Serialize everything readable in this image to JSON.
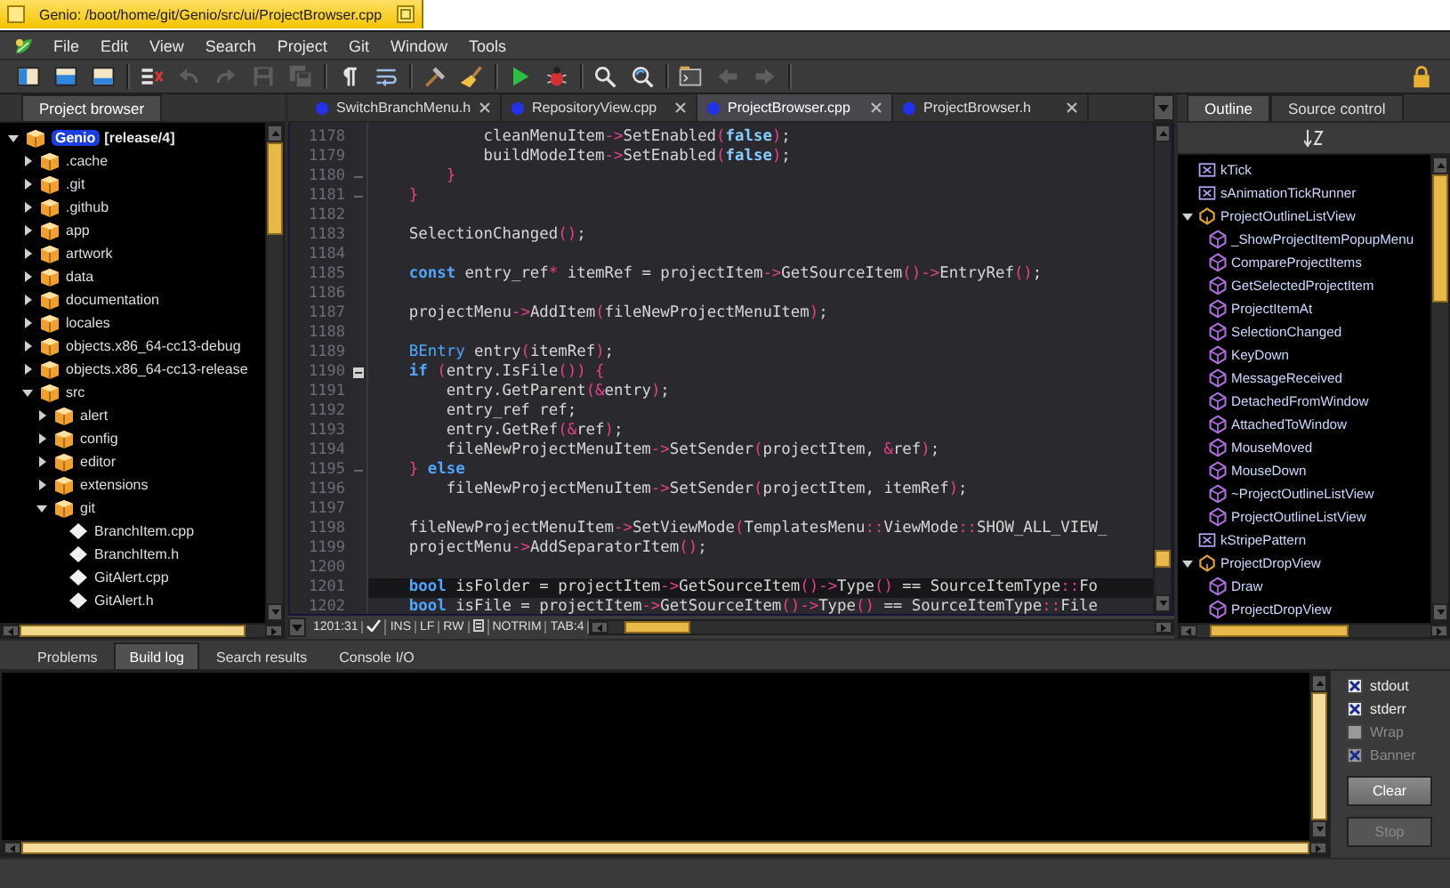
{
  "window": {
    "title": "Genio: /boot/home/git/Genio/src/ui/ProjectBrowser.cpp"
  },
  "menu": [
    "File",
    "Edit",
    "View",
    "Search",
    "Project",
    "Git",
    "Window",
    "Tools"
  ],
  "toolbar_groups": [
    [
      {
        "kind": "left-pane",
        "disabled": false
      },
      {
        "kind": "top-pane",
        "disabled": false
      },
      {
        "kind": "bottom-pane",
        "disabled": false
      }
    ],
    [
      {
        "kind": "targets",
        "disabled": false
      },
      {
        "kind": "undo",
        "disabled": true
      },
      {
        "kind": "redo",
        "disabled": true
      },
      {
        "kind": "save",
        "disabled": true
      },
      {
        "kind": "save-all",
        "disabled": true
      }
    ],
    [
      {
        "kind": "pilcrow",
        "disabled": false
      },
      {
        "kind": "wrap",
        "disabled": false
      }
    ],
    [
      {
        "kind": "hammer",
        "disabled": false
      },
      {
        "kind": "broom",
        "disabled": false
      }
    ],
    [
      {
        "kind": "run",
        "disabled": false
      },
      {
        "kind": "debug",
        "disabled": false
      }
    ],
    [
      {
        "kind": "find",
        "disabled": false
      },
      {
        "kind": "replace",
        "disabled": false
      }
    ],
    [
      {
        "kind": "terminal",
        "disabled": false
      },
      {
        "kind": "back",
        "disabled": true
      },
      {
        "kind": "forward",
        "disabled": true
      }
    ]
  ],
  "toolbar_end": [
    {
      "kind": "lock",
      "disabled": false
    }
  ],
  "project_browser": {
    "tab": "Project browser",
    "project": {
      "name": "Genio",
      "branch": "[release/4]",
      "active": true,
      "expanded": true,
      "children": [
        {
          "label": ".cache",
          "kind": "folder",
          "expanded": false
        },
        {
          "label": ".git",
          "kind": "folder",
          "expanded": false
        },
        {
          "label": ".github",
          "kind": "folder",
          "expanded": false
        },
        {
          "label": "app",
          "kind": "folder",
          "expanded": false
        },
        {
          "label": "artwork",
          "kind": "folder",
          "expanded": false
        },
        {
          "label": "data",
          "kind": "folder",
          "expanded": false
        },
        {
          "label": "documentation",
          "kind": "folder",
          "expanded": false
        },
        {
          "label": "locales",
          "kind": "folder",
          "expanded": false
        },
        {
          "label": "objects.x86_64-cc13-debug",
          "kind": "folder",
          "expanded": false
        },
        {
          "label": "objects.x86_64-cc13-release",
          "kind": "folder",
          "expanded": false
        },
        {
          "label": "src",
          "kind": "folder",
          "expanded": true,
          "children": [
            {
              "label": "alert",
              "kind": "folder",
              "expanded": false
            },
            {
              "label": "config",
              "kind": "folder",
              "expanded": false
            },
            {
              "label": "editor",
              "kind": "folder",
              "expanded": false
            },
            {
              "label": "extensions",
              "kind": "folder",
              "expanded": false
            },
            {
              "label": "git",
              "kind": "folder",
              "expanded": true,
              "children": [
                {
                  "label": "BranchItem.cpp",
                  "kind": "file"
                },
                {
                  "label": "BranchItem.h",
                  "kind": "file"
                },
                {
                  "label": "GitAlert.cpp",
                  "kind": "file"
                },
                {
                  "label": "GitAlert.h",
                  "kind": "file"
                }
              ]
            }
          ]
        }
      ]
    }
  },
  "editor": {
    "tabs": [
      {
        "label": "SwitchBranchMenu.h",
        "selected": false
      },
      {
        "label": "RepositoryView.cpp",
        "selected": false
      },
      {
        "label": "ProjectBrowser.cpp",
        "selected": true
      },
      {
        "label": "ProjectBrowser.h",
        "selected": false
      }
    ],
    "lines": [
      {
        "number": "1178",
        "current": false,
        "tokens": [
          {
            "kind": "plain",
            "text": "            cleanMenuItem"
          },
          {
            "kind": "symbol",
            "text": "->"
          },
          {
            "kind": "plain",
            "text": "SetEnabled"
          },
          {
            "kind": "symbol",
            "text": "("
          },
          {
            "kind": "literal",
            "text": "false"
          },
          {
            "kind": "symbol",
            "text": ")"
          },
          {
            "kind": "plain",
            "text": ";"
          }
        ]
      },
      {
        "number": "1179",
        "current": false,
        "tokens": [
          {
            "kind": "plain",
            "text": "            buildModeItem"
          },
          {
            "kind": "symbol",
            "text": "->"
          },
          {
            "kind": "plain",
            "text": "SetEnabled"
          },
          {
            "kind": "symbol",
            "text": "("
          },
          {
            "kind": "literal",
            "text": "false"
          },
          {
            "kind": "symbol",
            "text": ")"
          },
          {
            "kind": "plain",
            "text": ";"
          }
        ]
      },
      {
        "number": "1180",
        "current": false,
        "fold_end": true,
        "tokens": [
          {
            "kind": "symbol",
            "text": "        }"
          }
        ]
      },
      {
        "number": "1181",
        "current": false,
        "fold_end": true,
        "tokens": [
          {
            "kind": "symbol",
            "text": "    }"
          }
        ]
      },
      {
        "number": "1182"
      },
      {
        "number": "1183",
        "current": false,
        "tokens": [
          {
            "kind": "plain",
            "text": "    SelectionChanged"
          },
          {
            "kind": "symbol",
            "text": "()"
          },
          {
            "kind": "plain",
            "text": ";"
          }
        ]
      },
      {
        "number": "1184"
      },
      {
        "number": "1185",
        "current": false,
        "tokens": [
          {
            "kind": "keyword",
            "text": "    const"
          },
          {
            "kind": "plain",
            "text": " entry_ref"
          },
          {
            "kind": "symbol",
            "text": "*"
          },
          {
            "kind": "plain",
            "text": " itemRef = projectItem"
          },
          {
            "kind": "symbol",
            "text": "->"
          },
          {
            "kind": "plain",
            "text": "GetSourceItem"
          },
          {
            "kind": "symbol",
            "text": "()->"
          },
          {
            "kind": "plain",
            "text": "EntryRef"
          },
          {
            "kind": "symbol",
            "text": "()"
          },
          {
            "kind": "plain",
            "text": ";"
          }
        ]
      },
      {
        "number": "1186"
      },
      {
        "number": "1187",
        "current": false,
        "tokens": [
          {
            "kind": "plain",
            "text": "    projectMenu"
          },
          {
            "kind": "symbol",
            "text": "->"
          },
          {
            "kind": "plain",
            "text": "AddItem"
          },
          {
            "kind": "symbol",
            "text": "("
          },
          {
            "kind": "plain",
            "text": "fileNewProjectMenuItem"
          },
          {
            "kind": "symbol",
            "text": ")"
          },
          {
            "kind": "plain",
            "text": ";"
          }
        ]
      },
      {
        "number": "1188"
      },
      {
        "number": "1189",
        "current": false,
        "tokens": [
          {
            "kind": "type",
            "text": "    BEntry"
          },
          {
            "kind": "plain",
            "text": " entry"
          },
          {
            "kind": "symbol",
            "text": "("
          },
          {
            "kind": "plain",
            "text": "itemRef"
          },
          {
            "kind": "symbol",
            "text": ")"
          },
          {
            "kind": "plain",
            "text": ";"
          }
        ]
      },
      {
        "number": "1190",
        "current": false,
        "fold_start": true,
        "tokens": [
          {
            "kind": "keyword",
            "text": "    if"
          },
          {
            "kind": "symbol",
            "text": " ("
          },
          {
            "kind": "plain",
            "text": "entry.IsFile"
          },
          {
            "kind": "symbol",
            "text": "()) {"
          }
        ]
      },
      {
        "number": "1191",
        "current": false,
        "tokens": [
          {
            "kind": "plain",
            "text": "        entry.GetParent"
          },
          {
            "kind": "symbol",
            "text": "(&"
          },
          {
            "kind": "plain",
            "text": "entry"
          },
          {
            "kind": "symbol",
            "text": ")"
          },
          {
            "kind": "plain",
            "text": ";"
          }
        ]
      },
      {
        "number": "1192",
        "current": false,
        "tokens": [
          {
            "kind": "plain",
            "text": "        entry_ref ref;"
          }
        ]
      },
      {
        "number": "1193",
        "current": false,
        "tokens": [
          {
            "kind": "plain",
            "text": "        entry.GetRef"
          },
          {
            "kind": "symbol",
            "text": "(&"
          },
          {
            "kind": "plain",
            "text": "ref"
          },
          {
            "kind": "symbol",
            "text": ")"
          },
          {
            "kind": "plain",
            "text": ";"
          }
        ]
      },
      {
        "number": "1194",
        "current": false,
        "tokens": [
          {
            "kind": "plain",
            "text": "        fileNewProjectMenuItem"
          },
          {
            "kind": "symbol",
            "text": "->"
          },
          {
            "kind": "plain",
            "text": "SetSender"
          },
          {
            "kind": "symbol",
            "text": "("
          },
          {
            "kind": "plain",
            "text": "projectItem, "
          },
          {
            "kind": "symbol",
            "text": "&"
          },
          {
            "kind": "plain",
            "text": "ref"
          },
          {
            "kind": "symbol",
            "text": ")"
          },
          {
            "kind": "plain",
            "text": ";"
          }
        ]
      },
      {
        "number": "1195",
        "current": false,
        "fold_end": true,
        "tokens": [
          {
            "kind": "symbol",
            "text": "    }"
          },
          {
            "kind": "keyword",
            "text": " else"
          }
        ]
      },
      {
        "number": "1196",
        "current": false,
        "tokens": [
          {
            "kind": "plain",
            "text": "        fileNewProjectMenuItem"
          },
          {
            "kind": "symbol",
            "text": "->"
          },
          {
            "kind": "plain",
            "text": "SetSender"
          },
          {
            "kind": "symbol",
            "text": "("
          },
          {
            "kind": "plain",
            "text": "projectItem, itemRef"
          },
          {
            "kind": "symbol",
            "text": ")"
          },
          {
            "kind": "plain",
            "text": ";"
          }
        ]
      },
      {
        "number": "1197"
      },
      {
        "number": "1198",
        "current": false,
        "tokens": [
          {
            "kind": "plain",
            "text": "    fileNewProjectMenuItem"
          },
          {
            "kind": "symbol",
            "text": "->"
          },
          {
            "kind": "plain",
            "text": "SetViewMode"
          },
          {
            "kind": "symbol",
            "text": "("
          },
          {
            "kind": "plain",
            "text": "TemplatesMenu"
          },
          {
            "kind": "symbol",
            "text": "::"
          },
          {
            "kind": "plain",
            "text": "ViewMode"
          },
          {
            "kind": "symbol",
            "text": "::"
          },
          {
            "kind": "plain",
            "text": "SHOW_ALL_VIEW_"
          }
        ]
      },
      {
        "number": "1199",
        "current": false,
        "tokens": [
          {
            "kind": "plain",
            "text": "    projectMenu"
          },
          {
            "kind": "symbol",
            "text": "->"
          },
          {
            "kind": "plain",
            "text": "AddSeparatorItem"
          },
          {
            "kind": "symbol",
            "text": "()"
          },
          {
            "kind": "plain",
            "text": ";"
          }
        ]
      },
      {
        "number": "1200"
      },
      {
        "number": "1201",
        "current": true,
        "tokens": [
          {
            "kind": "keyword",
            "text": "    bool"
          },
          {
            "kind": "plain",
            "text": " isFolder = projectItem"
          },
          {
            "kind": "symbol",
            "text": "->"
          },
          {
            "kind": "plain",
            "text": "GetSourceItem"
          },
          {
            "kind": "symbol",
            "text": "()->"
          },
          {
            "kind": "plain",
            "text": "Type"
          },
          {
            "kind": "symbol",
            "text": "()"
          },
          {
            "kind": "plain",
            "text": " == SourceItemType"
          },
          {
            "kind": "symbol",
            "text": "::"
          },
          {
            "kind": "plain",
            "text": "Fo"
          }
        ]
      },
      {
        "number": "1202",
        "current": false,
        "tokens": [
          {
            "kind": "keyword",
            "text": "    bool"
          },
          {
            "kind": "plain",
            "text": " isFile = projectItem"
          },
          {
            "kind": "symbol",
            "text": "->"
          },
          {
            "kind": "plain",
            "text": "GetSourceItem"
          },
          {
            "kind": "symbol",
            "text": "()->"
          },
          {
            "kind": "plain",
            "text": "Type"
          },
          {
            "kind": "symbol",
            "text": "()"
          },
          {
            "kind": "plain",
            "text": " == SourceItemType"
          },
          {
            "kind": "symbol",
            "text": "::"
          },
          {
            "kind": "plain",
            "text": "File"
          }
        ]
      }
    ],
    "status_bar": {
      "position": "1201:31",
      "saved": true,
      "mode": "INS",
      "line_ending": "LF",
      "access": "RW",
      "trim": "NOTRIM",
      "tab": "TAB:4"
    }
  },
  "outline": {
    "tabs": [
      {
        "label": "Outline",
        "selected": true
      },
      {
        "label": "Source control",
        "selected": false
      }
    ],
    "items": [
      {
        "label": "kTick",
        "kind": "constant"
      },
      {
        "label": "sAnimationTickRunner",
        "kind": "constant"
      },
      {
        "label": "ProjectOutlineListView",
        "kind": "class",
        "expanded": true,
        "children": [
          {
            "label": "_ShowProjectItemPopupMenu",
            "kind": "method"
          },
          {
            "label": "CompareProjectItems",
            "kind": "method"
          },
          {
            "label": "GetSelectedProjectItem",
            "kind": "method"
          },
          {
            "label": "ProjectItemAt",
            "kind": "method"
          },
          {
            "label": "SelectionChanged",
            "kind": "method"
          },
          {
            "label": "KeyDown",
            "kind": "method"
          },
          {
            "label": "MessageReceived",
            "kind": "method"
          },
          {
            "label": "DetachedFromWindow",
            "kind": "method"
          },
          {
            "label": "AttachedToWindow",
            "kind": "method"
          },
          {
            "label": "MouseMoved",
            "kind": "method"
          },
          {
            "label": "MouseDown",
            "kind": "method"
          },
          {
            "label": "~ProjectOutlineListView",
            "kind": "method"
          },
          {
            "label": "ProjectOutlineListView",
            "kind": "method"
          }
        ]
      },
      {
        "label": "kStripePattern",
        "kind": "constant"
      },
      {
        "label": "ProjectDropView",
        "kind": "class",
        "expanded": true,
        "children": [
          {
            "label": "Draw",
            "kind": "method"
          },
          {
            "label": "ProjectDropView",
            "kind": "method"
          }
        ]
      }
    ]
  },
  "output": {
    "tabs": [
      {
        "label": "Problems",
        "selected": false
      },
      {
        "label": "Build log",
        "selected": true
      },
      {
        "label": "Search results",
        "selected": false
      },
      {
        "label": "Console I/O",
        "selected": false
      }
    ],
    "options": [
      {
        "label": "stdout",
        "checked": true,
        "disabled": false
      },
      {
        "label": "stderr",
        "checked": true,
        "disabled": false
      },
      {
        "label": "Wrap",
        "checked": false,
        "disabled": true
      },
      {
        "label": "Banner",
        "checked": true,
        "disabled": true
      }
    ],
    "buttons": [
      {
        "label": "Clear",
        "disabled": false
      },
      {
        "label": "Stop",
        "disabled": true
      }
    ]
  }
}
